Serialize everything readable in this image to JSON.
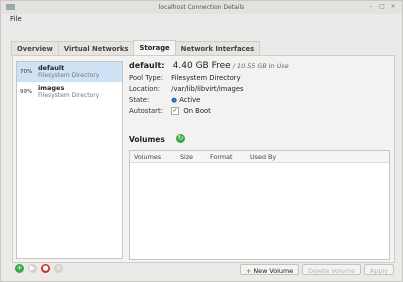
{
  "window": {
    "title": "localhost Connection Details"
  },
  "menubar": {
    "file": "File"
  },
  "tabs": [
    "Overview",
    "Virtual Networks",
    "Storage",
    "Network Interfaces"
  ],
  "pools": [
    {
      "usage": "70%",
      "name": "default",
      "type": "Filesystem Directory",
      "selected": true
    },
    {
      "usage": "99%",
      "name": "images",
      "type": "Filesystem Directory",
      "selected": false
    }
  ],
  "details": {
    "name": "default:",
    "free": "4.40 GB Free",
    "in_use": "/ 10.55 GB In Use",
    "pool_type_label": "Pool Type:",
    "pool_type": "Filesystem Directory",
    "location_label": "Location:",
    "location": "/var/lib/libvirt/images",
    "state_label": "State:",
    "state": "Active",
    "autostart_label": "Autostart:",
    "autostart": "On Boot",
    "volumes_label": "Volumes"
  },
  "volume_columns": [
    "Volumes",
    "Size",
    "Format",
    "Used By"
  ],
  "actions": {
    "new_volume": "New Volume",
    "delete_volume": "Delete Volume",
    "apply": "Apply"
  }
}
